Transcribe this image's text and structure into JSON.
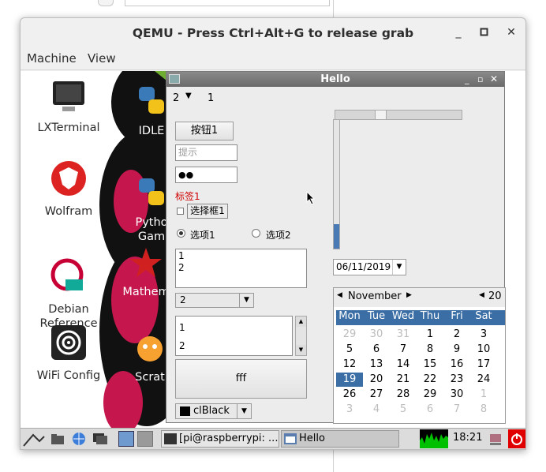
{
  "qemu": {
    "title": "QEMU - Press Ctrl+Alt+G to release grab",
    "menu": [
      "Machine",
      "View"
    ]
  },
  "desktop_icons": [
    {
      "label": "LXTerminal",
      "icon": "terminal-icon"
    },
    {
      "label": "Wolfram",
      "icon": "wolfram-icon"
    },
    {
      "label": "Debian\nReference",
      "icon": "debian-icon"
    },
    {
      "label": "WiFi Config",
      "icon": "wifi-icon"
    },
    {
      "label": "IDLE",
      "icon": "python-icon"
    },
    {
      "label": "Pytho\nGam",
      "icon": "python-icon"
    },
    {
      "label": "Mathem",
      "icon": "mathematica-icon"
    },
    {
      "label": "Scrat",
      "icon": "scratch-icon"
    }
  ],
  "hello": {
    "title": "Hello",
    "spin_value": "2",
    "spin_label": "1",
    "button1": "按钮1",
    "hint_placeholder": "提示",
    "password_dots": "●●",
    "label1": "标签1",
    "checkbox1": "选择框1",
    "radio1": "选项1",
    "radio2": "选项2",
    "memo_lines": [
      "1",
      "2"
    ],
    "combo_value": "2",
    "listbox_items": [
      "1",
      "2"
    ],
    "big_button": "fff",
    "color_combo": "clBlack",
    "date_value": "06/11/2019",
    "calendar": {
      "month": "November",
      "year_partial": "20",
      "weekdays": [
        "Mon",
        "Tue",
        "Wed",
        "Thu",
        "Fri",
        "Sat",
        "S"
      ],
      "weeks": [
        [
          "29",
          "30",
          "31",
          "1",
          "2",
          "3"
        ],
        [
          "5",
          "6",
          "7",
          "8",
          "9",
          "10"
        ],
        [
          "12",
          "13",
          "14",
          "15",
          "16",
          "17"
        ],
        [
          "19",
          "20",
          "21",
          "22",
          "23",
          "24"
        ],
        [
          "26",
          "27",
          "28",
          "29",
          "30",
          "1"
        ],
        [
          "3",
          "4",
          "5",
          "6",
          "7",
          "8"
        ]
      ],
      "selected_day": "19"
    }
  },
  "taskbar": {
    "task1": "[pi@raspberrypi: ...",
    "task2": "Hello",
    "clock": "18:21"
  },
  "colors": {
    "accent": "#3a6ea5",
    "red_label": "#d00000",
    "cpu_graph": "#00c000",
    "power": "#e00000"
  }
}
